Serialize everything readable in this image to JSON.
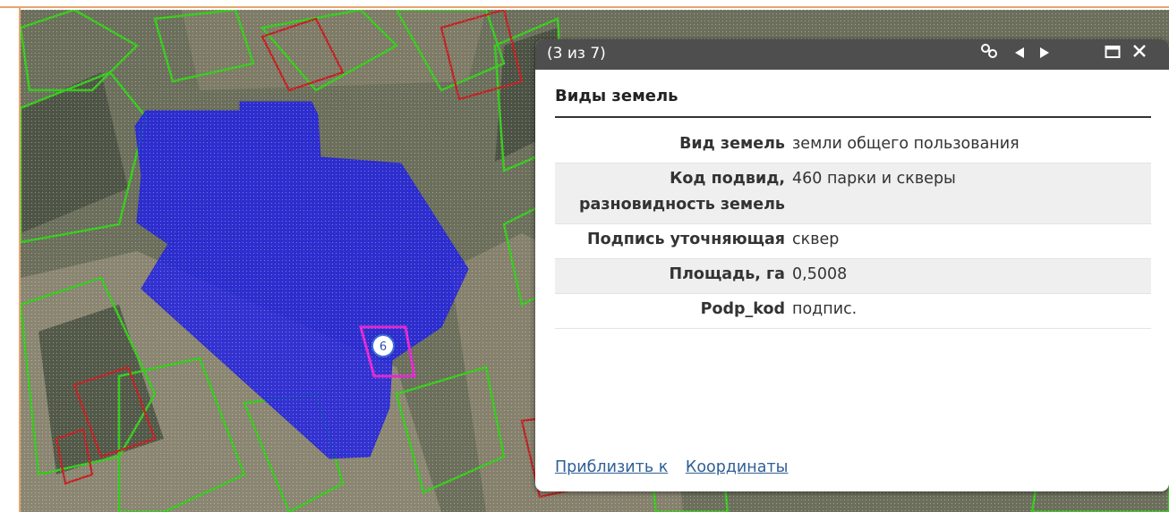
{
  "popup": {
    "counter": "(3 из 7)",
    "title": "Виды земель",
    "attributes": [
      {
        "key": "Вид земель",
        "value": "земли общего пользования"
      },
      {
        "key": "Код подвид, разновидность земель",
        "value": "460 парки и скверы"
      },
      {
        "key": "Подпись уточняющая",
        "value": "сквер"
      },
      {
        "key": "Площадь, га",
        "value": "0,5008"
      },
      {
        "key": "Podp_kod",
        "value": "подпис."
      }
    ],
    "links": {
      "zoom_to": "Приблизить к",
      "coordinates": "Координаты"
    },
    "icons": [
      "link-icon",
      "previous-icon",
      "next-icon",
      "maximize-icon",
      "close-icon"
    ]
  },
  "map": {
    "marker_label": "6",
    "selected_fill": "#2020e6",
    "parcel_green": "#38c81e",
    "parcel_red": "#c02222"
  },
  "colors": {
    "header": "#4e4e4e",
    "accent_border": "#e7a56e",
    "link": "#2f5f96"
  }
}
